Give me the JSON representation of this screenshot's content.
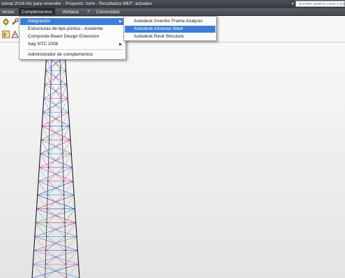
{
  "window": {
    "title": "sional 2016-No para revender - Proyecto: torre - Resultados MEF: actuales",
    "search_placeholder": "Escriba palabra clave o frase"
  },
  "menubar": {
    "items": [
      {
        "label": "ientas"
      },
      {
        "label": "Complementos"
      },
      {
        "label": "Ventana"
      },
      {
        "label": "?"
      },
      {
        "label": "Comunidad"
      }
    ]
  },
  "complementos_menu": {
    "items": [
      {
        "label": "Integración"
      },
      {
        "label": "Estructuras de tipo pórtico - Asistente"
      },
      {
        "label": "Composite Beam Design Extension"
      },
      {
        "label": "Italy NTC 2008"
      },
      {
        "label": "Administrador de complementos"
      }
    ]
  },
  "integracion_submenu": {
    "items": [
      {
        "label": "Autodesk Inventor Frame Analysis"
      },
      {
        "label": "Autodesk Advance Steel"
      },
      {
        "label": "Autodesk Revit Structure"
      }
    ]
  },
  "colors": {
    "menu_highlight": "#3d7fd6",
    "title_bar": "#3f444a",
    "viewport_bg": "#eeeeee"
  }
}
